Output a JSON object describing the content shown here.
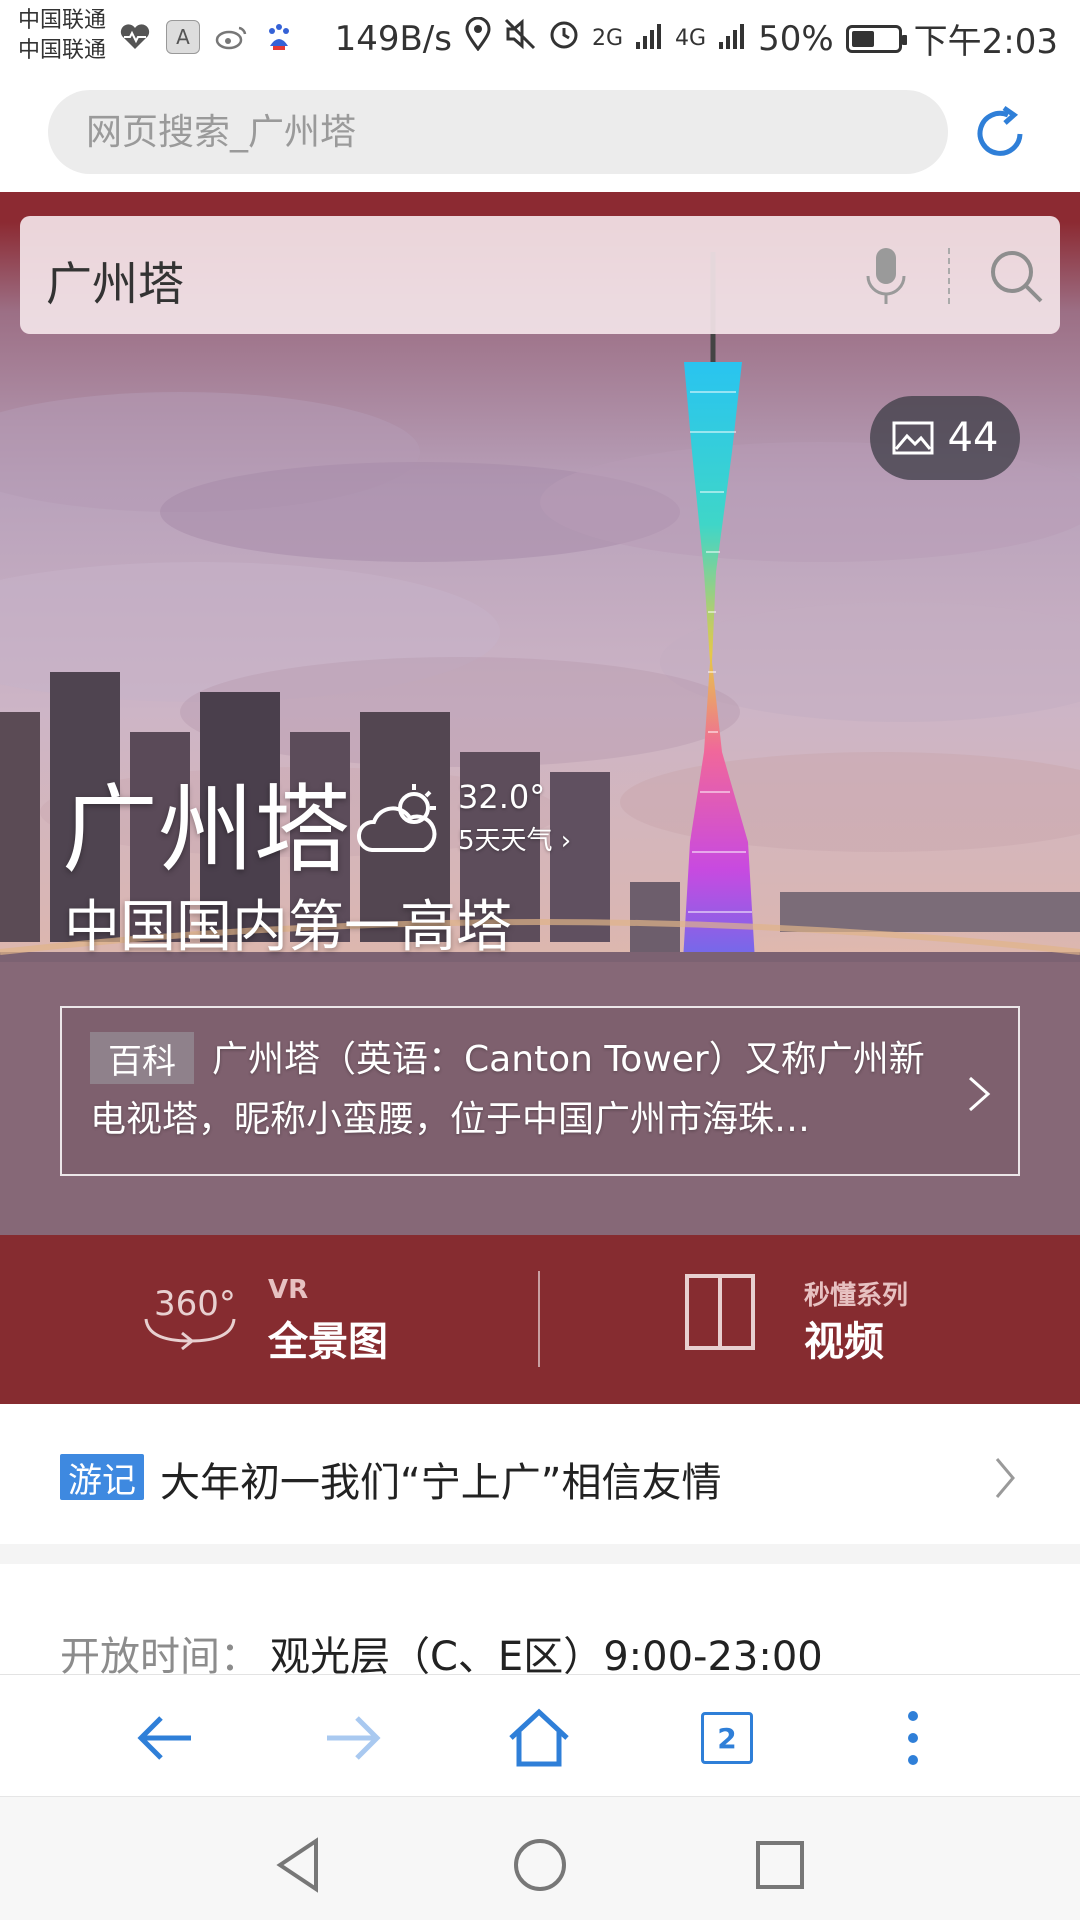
{
  "status_bar": {
    "carrier_1": "中国联通",
    "carrier_2": "中国联通",
    "net_speed": "149B/s",
    "signal_1": "2G",
    "signal_2": "4G",
    "battery": "50%",
    "battery_level": 0.5,
    "time": "下午2:03",
    "icons": [
      "heart-rate-icon",
      "a-icon",
      "weibo-icon",
      "baidu-icon",
      "location-icon",
      "mute-icon",
      "alarm-icon"
    ]
  },
  "url_bar": {
    "placeholder": "网页搜索_广州塔",
    "refresh_icon": "refresh-icon"
  },
  "hero": {
    "search_text": "广州塔",
    "photo_count": "44",
    "title": "广州塔",
    "temperature": "32.0°",
    "forecast_link": "5天天气 ›",
    "subtitle": "中国国内第一高塔",
    "encyclopedia": {
      "tag": "百科",
      "text": "广州塔（英语：Canton Tower）又称广州新电视塔，昵称小蛮腰，位于中国广州市海珠…"
    }
  },
  "features": {
    "vr": {
      "icon_text": "360°",
      "top": "VR",
      "main": "全景图"
    },
    "video": {
      "top": "秒懂系列",
      "main": "视频"
    }
  },
  "travel_note": {
    "tag": "游记",
    "text": "大年初一我们“宁上广”相信友情"
  },
  "hours": {
    "label": "开放时间：",
    "value": "观光层（C、E区）9:00-23:00"
  },
  "bottom_bar": {
    "tab_count": "2"
  },
  "colors": {
    "accent_blue": "#2f7fd8",
    "band_red": "#862c30",
    "tag_blue": "#3e89e0"
  }
}
